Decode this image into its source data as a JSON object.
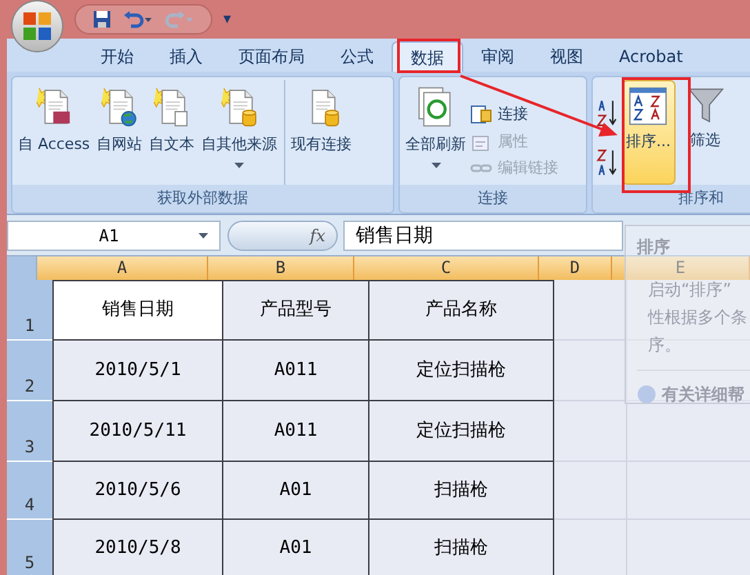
{
  "quick_access": {
    "customize": "▾"
  },
  "tabs": [
    {
      "label": "开始",
      "selected": false
    },
    {
      "label": "插入",
      "selected": false
    },
    {
      "label": "页面布局",
      "selected": false
    },
    {
      "label": "公式",
      "selected": false
    },
    {
      "label": "数据",
      "selected": true
    },
    {
      "label": "审阅",
      "selected": false
    },
    {
      "label": "视图",
      "selected": false
    },
    {
      "label": "Acrobat",
      "selected": false
    }
  ],
  "ribbon": {
    "groups": [
      {
        "label": "获取外部数据",
        "large": [
          {
            "label": "自 Access",
            "dropdown": false
          },
          {
            "label": "自网站",
            "dropdown": false
          },
          {
            "label": "自文本",
            "dropdown": false
          },
          {
            "label": "自其他来源",
            "dropdown": true
          },
          {
            "label": "现有连接",
            "dropdown": false
          }
        ]
      },
      {
        "label": "连接",
        "large": [
          {
            "label": "全部刷新",
            "dropdown": true
          }
        ],
        "small": [
          {
            "label": "连接",
            "disabled": false
          },
          {
            "label": "属性",
            "disabled": true
          },
          {
            "label": "编辑链接",
            "disabled": true
          }
        ]
      },
      {
        "label": "排序和",
        "sort_buttons": true,
        "large": [
          {
            "label": "排序...",
            "dropdown": false,
            "selected": true
          },
          {
            "label": "筛选",
            "dropdown": false,
            "selected": false
          }
        ]
      }
    ]
  },
  "formula_bar": {
    "name_box": "A1",
    "fx": "fx",
    "value": "销售日期"
  },
  "sheet": {
    "columns": [
      {
        "label": "A",
        "selected": true
      },
      {
        "label": "B",
        "selected": true
      },
      {
        "label": "C",
        "selected": true
      },
      {
        "label": "D",
        "selected": true
      },
      {
        "label": "E",
        "selected": true
      }
    ],
    "rows": [
      {
        "header": "1",
        "cells": [
          {
            "text": "销售日期",
            "active": true
          },
          {
            "text": "产品型号",
            "active": false
          },
          {
            "text": "产品名称",
            "active": false
          }
        ]
      },
      {
        "header": "2",
        "cells": [
          {
            "text": "2010/5/1",
            "active": false
          },
          {
            "text": "A011",
            "active": false
          },
          {
            "text": "定位扫描枪",
            "active": false
          }
        ]
      },
      {
        "header": "3",
        "cells": [
          {
            "text": "2010/5/11",
            "active": false
          },
          {
            "text": "A011",
            "active": false
          },
          {
            "text": "定位扫描枪",
            "active": false
          }
        ]
      },
      {
        "header": "4",
        "cells": [
          {
            "text": "2010/5/6",
            "active": false
          },
          {
            "text": "A01",
            "active": false
          },
          {
            "text": "扫描枪",
            "active": false
          }
        ]
      },
      {
        "header": "5",
        "cells": [
          {
            "text": "2010/5/8",
            "active": false
          },
          {
            "text": "A01",
            "active": false
          },
          {
            "text": "扫描枪",
            "active": false
          }
        ]
      }
    ]
  },
  "tooltip": {
    "title": "排序",
    "lines": [
      "启动“排序”",
      "性根据多个条",
      "序。"
    ],
    "help": "有关详细帮"
  }
}
